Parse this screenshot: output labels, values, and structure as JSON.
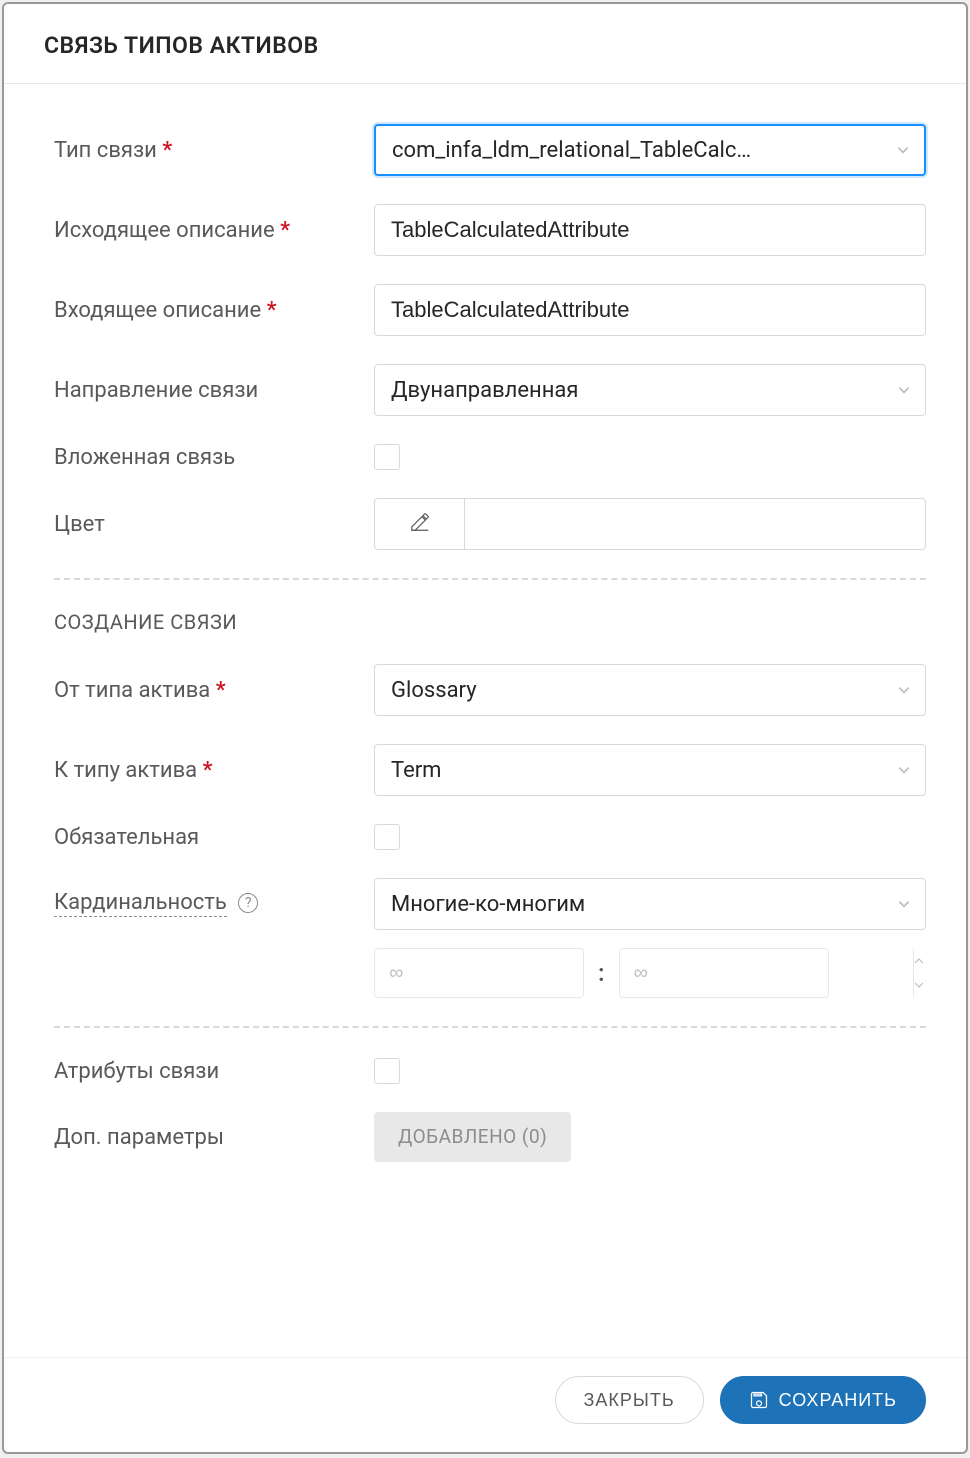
{
  "modal": {
    "title": "СВЯЗЬ ТИПОВ АКТИВОВ"
  },
  "labels": {
    "relation_type": "Тип связи",
    "outgoing_desc": "Исходящее описание",
    "incoming_desc": "Входящее описание",
    "direction": "Направление связи",
    "nested": "Вложенная связь",
    "color": "Цвет",
    "section_create": "СОЗДАНИЕ СВЯЗИ",
    "from_asset": "От типа актива",
    "to_asset": "К типу актива",
    "mandatory": "Обязательная",
    "cardinality": "Кардинальность",
    "relation_attrs": "Атрибуты связи",
    "extra_params": "Доп. параметры"
  },
  "values": {
    "relation_type": "com_infa_ldm_relational_TableCalc…",
    "outgoing_desc": "TableCalculatedAttribute",
    "incoming_desc": "TableCalculatedAttribute",
    "direction": "Двунаправленная",
    "from_asset": "Glossary",
    "to_asset": "Term",
    "cardinality": "Многие-ко-многим",
    "range_placeholder": "∞",
    "colon": ":",
    "added_button": "ДОБАВЛЕНО (0)"
  },
  "footer": {
    "close": "ЗАКРЫТЬ",
    "save": "СОХРАНИТЬ"
  }
}
